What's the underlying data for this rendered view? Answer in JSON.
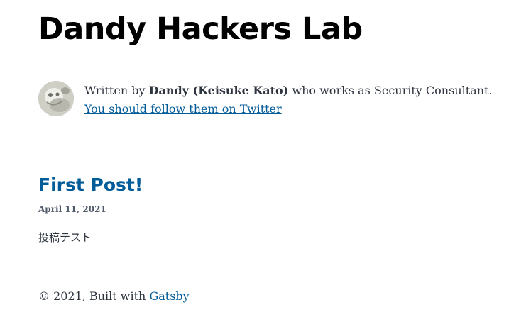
{
  "site": {
    "title": "Dandy Hackers Lab"
  },
  "bio": {
    "prefix": "Written by",
    "author": "Dandy (Keisuke Kato)",
    "suffix": "who works as Security Consultant.",
    "twitter_link": "You should follow them on Twitter",
    "avatar_icon": "author-avatar-icon"
  },
  "posts": [
    {
      "title": "First Post!",
      "date": "April 11, 2021",
      "description": "投稿テスト"
    }
  ],
  "footer": {
    "prefix": "© 2021, Built with",
    "link": "Gatsby"
  },
  "colors": {
    "link": "#005b99",
    "text": "#2e353f",
    "title": "#000000"
  }
}
